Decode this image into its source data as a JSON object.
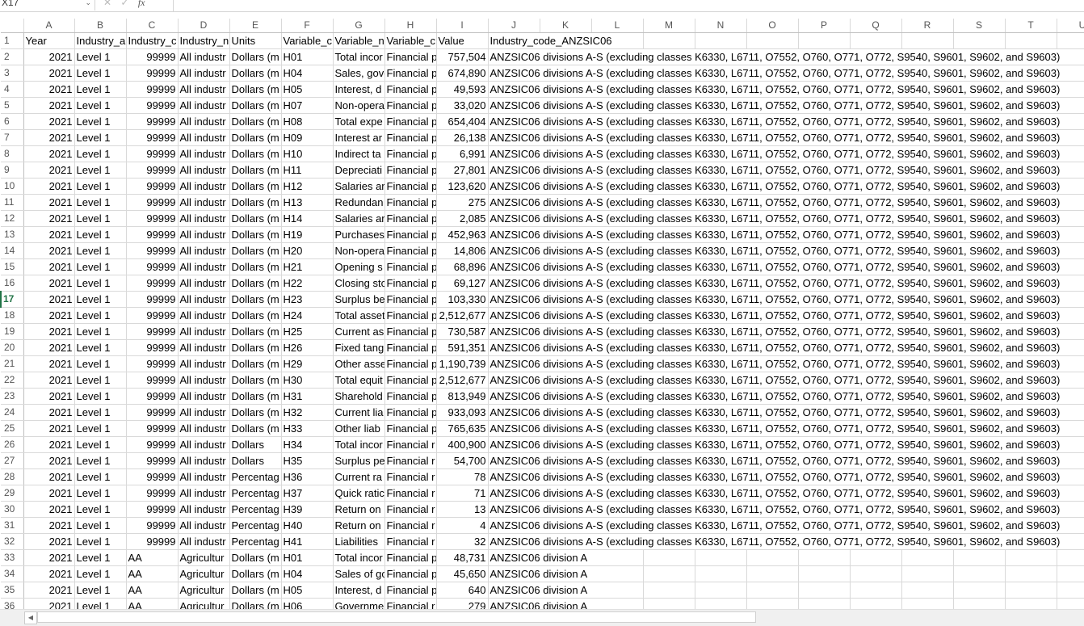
{
  "formula_bar": {
    "cell_ref": "X17",
    "fx": "fx",
    "cancel": "✕",
    "confirm": "✓"
  },
  "columns": [
    "A",
    "B",
    "C",
    "D",
    "E",
    "F",
    "G",
    "H",
    "I",
    "J",
    "K",
    "L",
    "M",
    "N",
    "O",
    "P",
    "Q",
    "R",
    "S",
    "T",
    "U"
  ],
  "selected_row": 17,
  "header_row": {
    "A": "Year",
    "B": "Industry_a",
    "C": "Industry_c",
    "D": "Industry_n",
    "E": "Units",
    "F": "Variable_c",
    "G": "Variable_n",
    "H": "Variable_c",
    "I": "Value",
    "J": "Industry_code_ANZSIC06"
  },
  "common": {
    "year": "2021",
    "level": "Level 1",
    "code_all": "99999",
    "name_all": "All industr",
    "code_aa": "AA",
    "name_agri": "Agricultur",
    "anz_all": "ANZSIC06 divisions A-S (excluding classes K6330, L6711, O7552, O760, O771, O772, S9540, S9601, S9602, and S9603)",
    "anz_a": "ANZSIC06 division A"
  },
  "rows": [
    {
      "n": "2",
      "c": "99999",
      "d": "All industr",
      "e": "Dollars (m",
      "f": "H01",
      "g": "Total incor",
      "h": "Financial p",
      "i": "757,504",
      "j": "all"
    },
    {
      "n": "3",
      "c": "99999",
      "d": "All industr",
      "e": "Dollars (m",
      "f": "H04",
      "g": "Sales, gove",
      "h": "Financial p",
      "i": "674,890",
      "j": "all"
    },
    {
      "n": "4",
      "c": "99999",
      "d": "All industr",
      "e": "Dollars (m",
      "f": "H05",
      "g": "Interest, d",
      "h": "Financial p",
      "i": "49,593",
      "j": "all"
    },
    {
      "n": "5",
      "c": "99999",
      "d": "All industr",
      "e": "Dollars (m",
      "f": "H07",
      "g": "Non-opera",
      "h": "Financial p",
      "i": "33,020",
      "j": "all"
    },
    {
      "n": "6",
      "c": "99999",
      "d": "All industr",
      "e": "Dollars (m",
      "f": "H08",
      "g": "Total expe",
      "h": "Financial p",
      "i": "654,404",
      "j": "all"
    },
    {
      "n": "7",
      "c": "99999",
      "d": "All industr",
      "e": "Dollars (m",
      "f": "H09",
      "g": "Interest ar",
      "h": "Financial p",
      "i": "26,138",
      "j": "all"
    },
    {
      "n": "8",
      "c": "99999",
      "d": "All industr",
      "e": "Dollars (m",
      "f": "H10",
      "g": "Indirect ta",
      "h": "Financial p",
      "i": "6,991",
      "j": "all"
    },
    {
      "n": "9",
      "c": "99999",
      "d": "All industr",
      "e": "Dollars (m",
      "f": "H11",
      "g": "Depreciati",
      "h": "Financial p",
      "i": "27,801",
      "j": "all"
    },
    {
      "n": "10",
      "c": "99999",
      "d": "All industr",
      "e": "Dollars (m",
      "f": "H12",
      "g": "Salaries ar",
      "h": "Financial p",
      "i": "123,620",
      "j": "all"
    },
    {
      "n": "11",
      "c": "99999",
      "d": "All industr",
      "e": "Dollars (m",
      "f": "H13",
      "g": "Redundan",
      "h": "Financial p",
      "i": "275",
      "j": "all"
    },
    {
      "n": "12",
      "c": "99999",
      "d": "All industr",
      "e": "Dollars (m",
      "f": "H14",
      "g": "Salaries ar",
      "h": "Financial p",
      "i": "2,085",
      "j": "all"
    },
    {
      "n": "13",
      "c": "99999",
      "d": "All industr",
      "e": "Dollars (m",
      "f": "H19",
      "g": "Purchases",
      "h": "Financial p",
      "i": "452,963",
      "j": "all"
    },
    {
      "n": "14",
      "c": "99999",
      "d": "All industr",
      "e": "Dollars (m",
      "f": "H20",
      "g": "Non-opera",
      "h": "Financial p",
      "i": "14,806",
      "j": "all"
    },
    {
      "n": "15",
      "c": "99999",
      "d": "All industr",
      "e": "Dollars (m",
      "f": "H21",
      "g": "Opening s",
      "h": "Financial p",
      "i": "68,896",
      "j": "all"
    },
    {
      "n": "16",
      "c": "99999",
      "d": "All industr",
      "e": "Dollars (m",
      "f": "H22",
      "g": "Closing stc",
      "h": "Financial p",
      "i": "69,127",
      "j": "all"
    },
    {
      "n": "17",
      "c": "99999",
      "d": "All industr",
      "e": "Dollars (m",
      "f": "H23",
      "g": "Surplus be",
      "h": "Financial p",
      "i": "103,330",
      "j": "all"
    },
    {
      "n": "18",
      "c": "99999",
      "d": "All industr",
      "e": "Dollars (m",
      "f": "H24",
      "g": "Total asset",
      "h": "Financial p",
      "i": "2,512,677",
      "j": "all"
    },
    {
      "n": "19",
      "c": "99999",
      "d": "All industr",
      "e": "Dollars (m",
      "f": "H25",
      "g": "Current as",
      "h": "Financial p",
      "i": "730,587",
      "j": "all"
    },
    {
      "n": "20",
      "c": "99999",
      "d": "All industr",
      "e": "Dollars (m",
      "f": "H26",
      "g": "Fixed tang",
      "h": "Financial p",
      "i": "591,351",
      "j": "all"
    },
    {
      "n": "21",
      "c": "99999",
      "d": "All industr",
      "e": "Dollars (m",
      "f": "H29",
      "g": "Other asse",
      "h": "Financial p",
      "i": "1,190,739",
      "j": "all"
    },
    {
      "n": "22",
      "c": "99999",
      "d": "All industr",
      "e": "Dollars (m",
      "f": "H30",
      "g": "Total equit",
      "h": "Financial p",
      "i": "2,512,677",
      "j": "all"
    },
    {
      "n": "23",
      "c": "99999",
      "d": "All industr",
      "e": "Dollars (m",
      "f": "H31",
      "g": "Sharehold",
      "h": "Financial p",
      "i": "813,949",
      "j": "all"
    },
    {
      "n": "24",
      "c": "99999",
      "d": "All industr",
      "e": "Dollars (m",
      "f": "H32",
      "g": "Current lia",
      "h": "Financial p",
      "i": "933,093",
      "j": "all"
    },
    {
      "n": "25",
      "c": "99999",
      "d": "All industr",
      "e": "Dollars (m",
      "f": "H33",
      "g": "Other liab",
      "h": "Financial p",
      "i": "765,635",
      "j": "all"
    },
    {
      "n": "26",
      "c": "99999",
      "d": "All industr",
      "e": "Dollars",
      "f": "H34",
      "g": "Total incor",
      "h": "Financial r",
      "i": "400,900",
      "j": "all"
    },
    {
      "n": "27",
      "c": "99999",
      "d": "All industr",
      "e": "Dollars",
      "f": "H35",
      "g": "Surplus pe",
      "h": "Financial r",
      "i": "54,700",
      "j": "all"
    },
    {
      "n": "28",
      "c": "99999",
      "d": "All industr",
      "e": "Percentag",
      "f": "H36",
      "g": "Current ra",
      "h": "Financial r",
      "i": "78",
      "j": "all"
    },
    {
      "n": "29",
      "c": "99999",
      "d": "All industr",
      "e": "Percentag",
      "f": "H37",
      "g": "Quick ratic",
      "h": "Financial r",
      "i": "71",
      "j": "all"
    },
    {
      "n": "30",
      "c": "99999",
      "d": "All industr",
      "e": "Percentag",
      "f": "H39",
      "g": "Return on",
      "h": "Financial r",
      "i": "13",
      "j": "all"
    },
    {
      "n": "31",
      "c": "99999",
      "d": "All industr",
      "e": "Percentag",
      "f": "H40",
      "g": "Return on",
      "h": "Financial r",
      "i": "4",
      "j": "all"
    },
    {
      "n": "32",
      "c": "99999",
      "d": "All industr",
      "e": "Percentag",
      "f": "H41",
      "g": "Liabilities",
      "h": "Financial r",
      "i": "32",
      "j": "all"
    },
    {
      "n": "33",
      "c": "AA",
      "d": "Agricultur",
      "e": "Dollars (m",
      "f": "H01",
      "g": "Total incor",
      "h": "Financial p",
      "i": "48,731",
      "j": "a"
    },
    {
      "n": "34",
      "c": "AA",
      "d": "Agricultur",
      "e": "Dollars (m",
      "f": "H04",
      "g": "Sales of gc",
      "h": "Financial p",
      "i": "45,650",
      "j": "a"
    },
    {
      "n": "35",
      "c": "AA",
      "d": "Agricultur",
      "e": "Dollars (m",
      "f": "H05",
      "g": "Interest, d",
      "h": "Financial p",
      "i": "640",
      "j": "a"
    },
    {
      "n": "36",
      "c": "AA",
      "d": "Agricultur",
      "e": "Dollars (m",
      "f": "H06",
      "g": "Governme",
      "h": "Financial r",
      "i": "279",
      "j": "a"
    }
  ]
}
